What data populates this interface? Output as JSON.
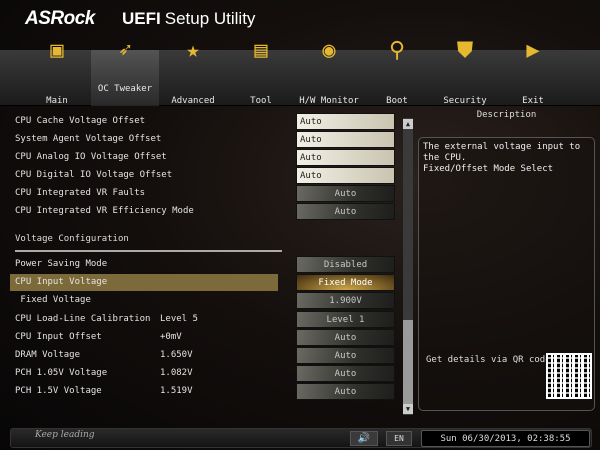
{
  "header": {
    "brand": "ASRock",
    "title_bold": "UEFI",
    "title": "Setup Utility"
  },
  "nav": [
    {
      "label": "Main",
      "icon": "monitor-icon",
      "glyph": "▣"
    },
    {
      "label": "OC Tweaker",
      "icon": "rocket-icon",
      "glyph": "➶"
    },
    {
      "label": "Advanced",
      "icon": "star-icon",
      "glyph": "★"
    },
    {
      "label": "Tool",
      "icon": "toolbox-icon",
      "glyph": "▤"
    },
    {
      "label": "H/W Monitor",
      "icon": "radar-icon",
      "glyph": "◉"
    },
    {
      "label": "Boot",
      "icon": "joystick-icon",
      "glyph": "⚲"
    },
    {
      "label": "Security",
      "icon": "shield-icon",
      "glyph": "⛊"
    },
    {
      "label": "Exit",
      "icon": "exit-door-icon",
      "glyph": "▶"
    }
  ],
  "selected_tab": "OC Tweaker",
  "rows_top": [
    {
      "label": "CPU Cache Voltage Offset",
      "value": "Auto",
      "style": "light"
    },
    {
      "label": "System Agent Voltage Offset",
      "value": "Auto",
      "style": "light"
    },
    {
      "label": "CPU Analog IO Voltage Offset",
      "value": "Auto",
      "style": "light"
    },
    {
      "label": "CPU Digital IO Voltage Offset",
      "value": "Auto",
      "style": "light"
    },
    {
      "label": "CPU Integrated VR Faults",
      "value": "Auto",
      "style": "dark"
    },
    {
      "label": "CPU Integrated VR Efficiency Mode",
      "value": "Auto",
      "style": "dark"
    }
  ],
  "section": "Voltage Configuration",
  "rows_bottom": [
    {
      "label": "Power Saving Mode",
      "current": "",
      "value": "Disabled"
    },
    {
      "label": "CPU Input Voltage",
      "current": "",
      "value": "Fixed Mode"
    },
    {
      "label": " Fixed Voltage",
      "current": "",
      "value": "1.900V"
    },
    {
      "label": "CPU Load-Line Calibration",
      "current": "Level 5",
      "value": "Level 1"
    },
    {
      "label": "CPU Input Offset",
      "current": "+0mV",
      "value": "Auto"
    },
    {
      "label": "DRAM Voltage",
      "current": "1.650V",
      "value": "Auto"
    },
    {
      "label": "PCH 1.05V Voltage",
      "current": "1.082V",
      "value": "Auto"
    },
    {
      "label": "PCH 1.5V Voltage",
      "current": "1.519V",
      "value": "Auto"
    }
  ],
  "description": {
    "title": "Description",
    "text": "The external voltage input to the CPU.\nFixed/Offset Mode Select",
    "qr_label": "Get details via QR code"
  },
  "footer": {
    "tagline": "Keep leading",
    "language": "EN",
    "datetime": "Sun 06/30/2013, 02:38:55"
  }
}
